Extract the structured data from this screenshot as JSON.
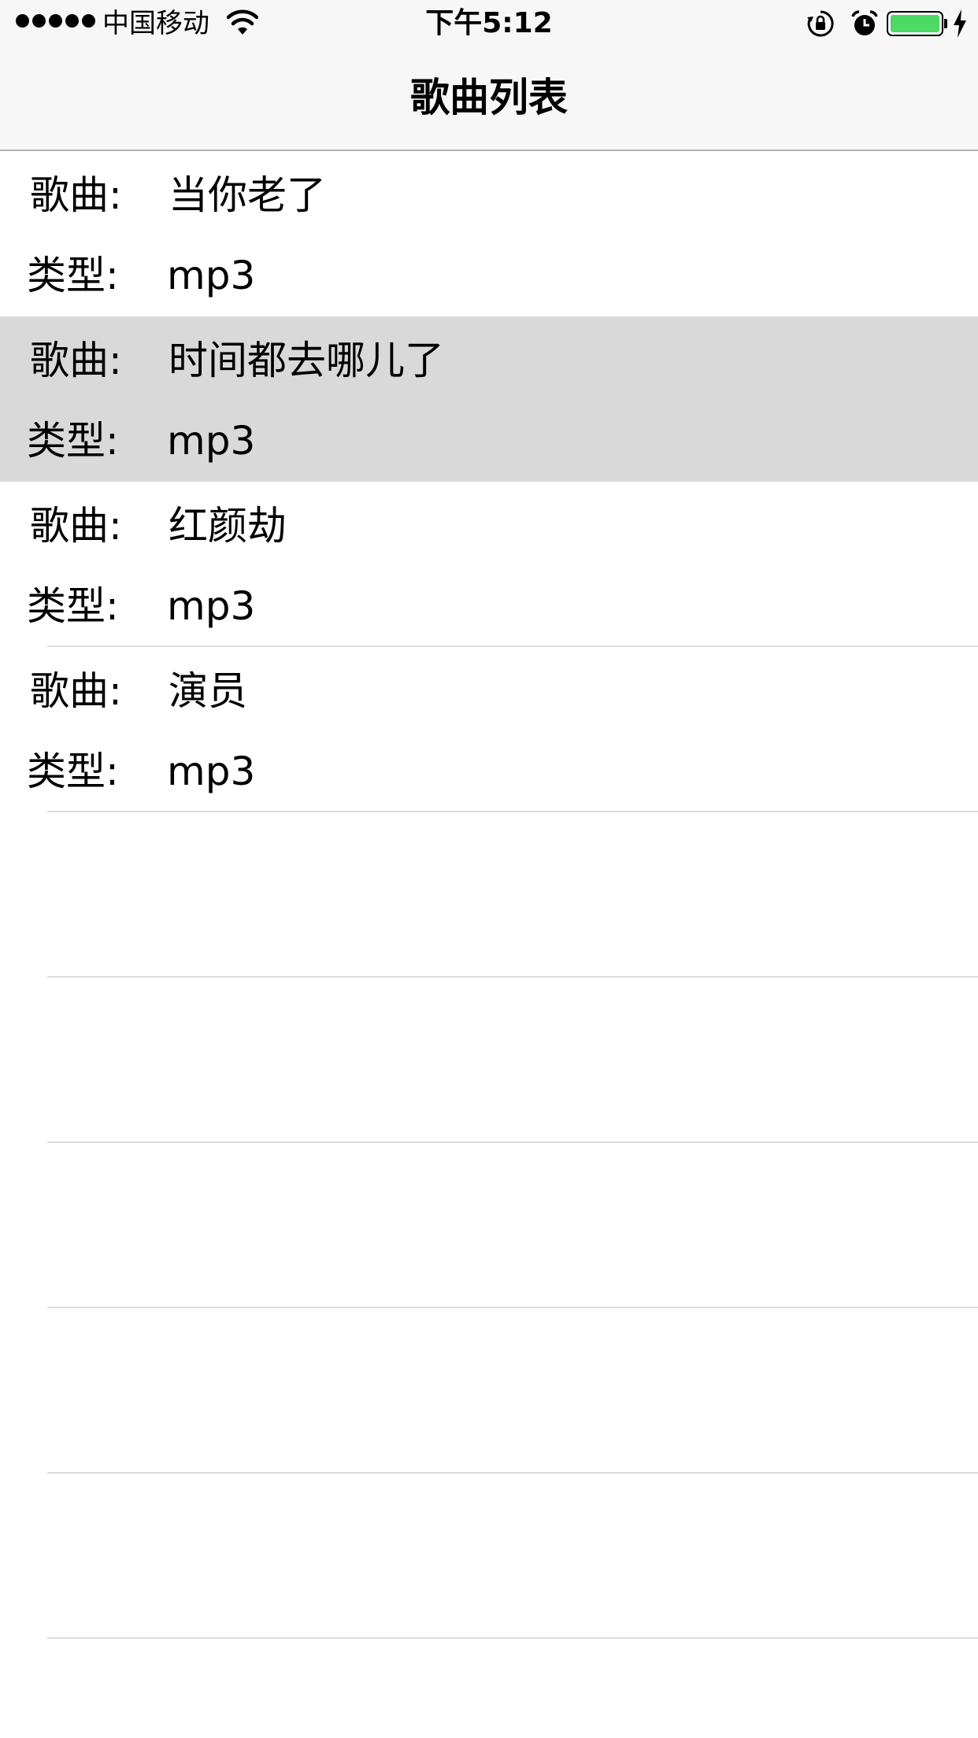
{
  "status_bar": {
    "carrier": "中国移动",
    "time": "下午5:12",
    "signal_icon": "signal-dots-icon",
    "wifi_icon": "wifi-icon",
    "rotation_lock_icon": "rotation-lock-icon",
    "alarm_icon": "alarm-icon",
    "battery_icon": "battery-icon",
    "charging_icon": "charging-bolt-icon",
    "battery_color": "#4cd964"
  },
  "nav": {
    "title": "歌曲列表"
  },
  "songs": [
    {
      "song_label": "歌曲:",
      "song": "当你老了",
      "type_label": "类型:",
      "type": "mp3",
      "selected": false
    },
    {
      "song_label": "歌曲:",
      "song": "时间都去哪儿了",
      "type_label": "类型:",
      "type": "mp3",
      "selected": true
    },
    {
      "song_label": "歌曲:",
      "song": "红颜劫",
      "type_label": "类型:",
      "type": "mp3",
      "selected": false
    },
    {
      "song_label": "歌曲:",
      "song": "演员",
      "type_label": "类型:",
      "type": "mp3",
      "selected": false
    }
  ],
  "colors": {
    "selected_row": "#d9d9d9",
    "separator": "#dcdcdf",
    "bar_background": "#f7f7f7"
  }
}
